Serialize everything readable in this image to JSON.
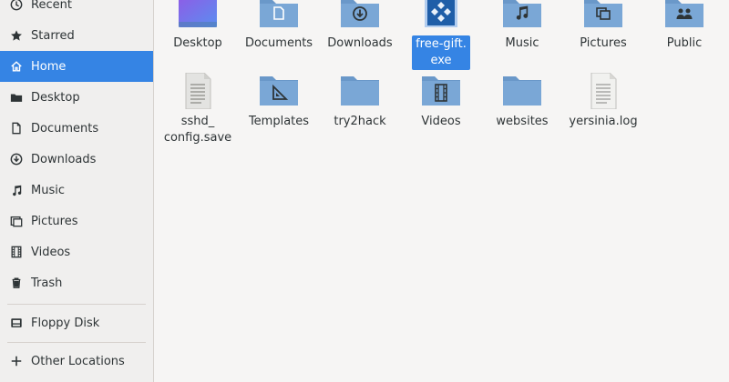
{
  "sidebar": {
    "items": [
      {
        "label": "Recent",
        "icon": "clock-icon"
      },
      {
        "label": "Starred",
        "icon": "star-icon"
      },
      {
        "label": "Home",
        "icon": "home-icon"
      },
      {
        "label": "Desktop",
        "icon": "desktop-icon"
      },
      {
        "label": "Documents",
        "icon": "document-icon"
      },
      {
        "label": "Downloads",
        "icon": "download-icon"
      },
      {
        "label": "Music",
        "icon": "music-note-icon"
      },
      {
        "label": "Pictures",
        "icon": "pictures-icon"
      },
      {
        "label": "Videos",
        "icon": "film-icon"
      },
      {
        "label": "Trash",
        "icon": "trash-icon"
      },
      {
        "label": "Floppy Disk",
        "icon": "floppy-disk-icon"
      },
      {
        "label": "Other Locations",
        "icon": "plus-icon"
      }
    ],
    "active_item": "Home"
  },
  "files": {
    "row1": [
      {
        "name": "Desktop",
        "icon": "desktop-folder-icon"
      },
      {
        "name": "Documents",
        "icon": "documents-folder-icon"
      },
      {
        "name": "Downloads",
        "icon": "downloads-folder-icon"
      },
      {
        "name": "free-gift.\nexe",
        "icon": "executable-icon",
        "selected": true
      },
      {
        "name": "Music",
        "icon": "music-folder-icon"
      },
      {
        "name": "Pictures",
        "icon": "pictures-folder-icon"
      },
      {
        "name": "Public",
        "icon": "public-folder-icon"
      }
    ],
    "row2": [
      {
        "name": "sshd_\nconfig.save",
        "icon": "text-file-icon"
      },
      {
        "name": "Templates",
        "icon": "templates-folder-icon"
      },
      {
        "name": "try2hack",
        "icon": "folder-icon"
      },
      {
        "name": "Videos",
        "icon": "videos-folder-icon"
      },
      {
        "name": "websites",
        "icon": "folder-icon"
      },
      {
        "name": "yersinia.log",
        "icon": "text-file-icon"
      }
    ]
  },
  "colors": {
    "accent": "#3584e4",
    "folder": "#6a98c9",
    "folder_dark": "#4f7fb3",
    "sidebar_bg": "#f0efee",
    "content_bg": "#f6f5f4"
  }
}
